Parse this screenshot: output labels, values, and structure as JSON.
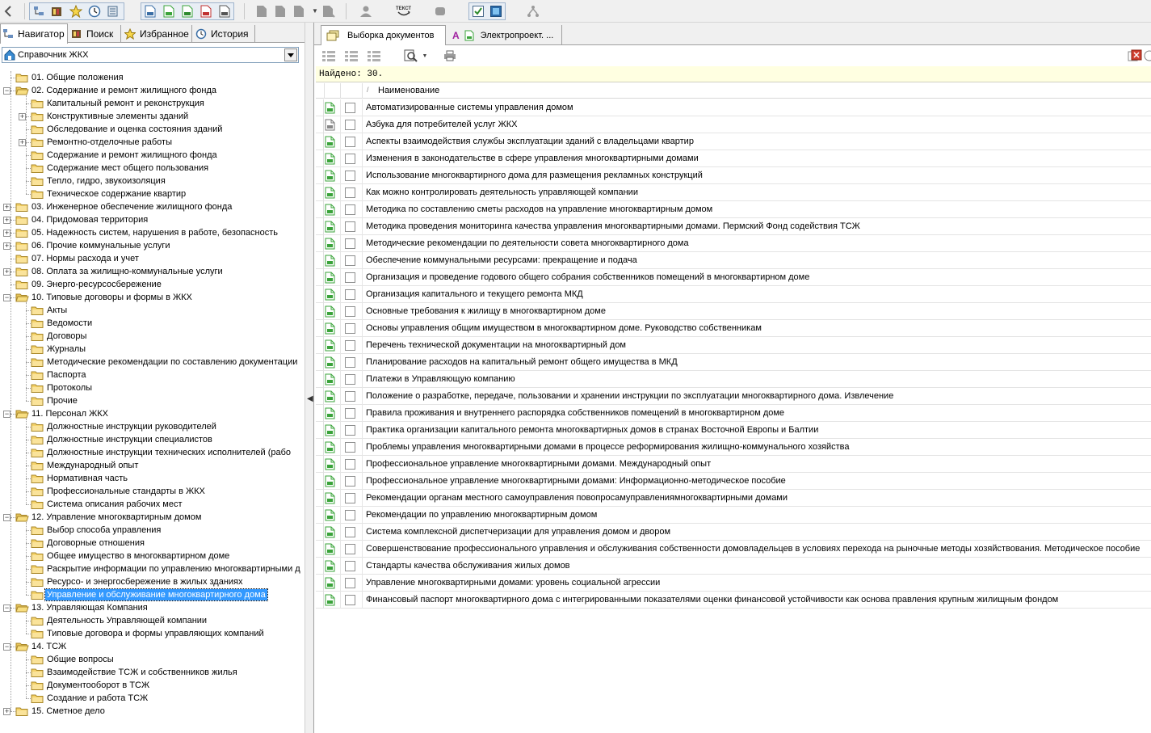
{
  "toolbar": {
    "icons": [
      "back-icon",
      "navigator-icon",
      "library-icon",
      "star-icon",
      "history-icon",
      "server-icon",
      "doc-blue-icon",
      "doc-green-icon",
      "doc-green2-icon",
      "doc-red-icon",
      "doc-gray-icon",
      "page-icon",
      "page2-icon",
      "page3-icon",
      "page4-icon",
      "user-icon",
      "text-icon",
      "stamp-icon",
      "check-icon",
      "window-icon",
      "tree-icon"
    ],
    "text_button_label": "ТЕКСТ"
  },
  "left_tabs": [
    {
      "label": "Навигатор",
      "icon": "navigator-icon",
      "active": true
    },
    {
      "label": "Поиск",
      "icon": "search-book-icon",
      "active": false
    },
    {
      "label": "Избранное",
      "icon": "star-icon",
      "active": false
    },
    {
      "label": "История",
      "icon": "clock-icon",
      "active": false
    }
  ],
  "directory_select": {
    "value": "Справочник ЖКХ"
  },
  "tree": [
    {
      "label": "01. Общие положения",
      "level": 0,
      "toggle": ""
    },
    {
      "label": "02. Содержание и ремонт жилищного фонда",
      "level": 0,
      "toggle": "−"
    },
    {
      "label": "Капитальный ремонт и реконструкция",
      "level": 1,
      "toggle": ""
    },
    {
      "label": "Конструктивные элементы зданий",
      "level": 1,
      "toggle": "+"
    },
    {
      "label": "Обследование и оценка состояния зданий",
      "level": 1,
      "toggle": ""
    },
    {
      "label": "Ремонтно-отделочные работы",
      "level": 1,
      "toggle": "+"
    },
    {
      "label": "Содержание и ремонт жилищного фонда",
      "level": 1,
      "toggle": ""
    },
    {
      "label": "Содержание мест общего пользования",
      "level": 1,
      "toggle": ""
    },
    {
      "label": "Тепло, гидро, звукоизоляция",
      "level": 1,
      "toggle": ""
    },
    {
      "label": "Техническое содержание квартир",
      "level": 1,
      "toggle": ""
    },
    {
      "label": "03. Инженерное обеспечение жилищного фонда",
      "level": 0,
      "toggle": "+"
    },
    {
      "label": "04. Придомовая территория",
      "level": 0,
      "toggle": "+"
    },
    {
      "label": "05. Надежность систем, нарушения в работе, безопасность",
      "level": 0,
      "toggle": "+"
    },
    {
      "label": "06. Прочие коммунальные услуги",
      "level": 0,
      "toggle": "+"
    },
    {
      "label": "07. Нормы расхода и учет",
      "level": 0,
      "toggle": ""
    },
    {
      "label": "08. Оплата за жилищно-коммунальные услуги",
      "level": 0,
      "toggle": "+"
    },
    {
      "label": "09. Энерго-ресурсосбережение",
      "level": 0,
      "toggle": ""
    },
    {
      "label": "10. Типовые договоры и формы в ЖКХ",
      "level": 0,
      "toggle": "−"
    },
    {
      "label": "Акты",
      "level": 1,
      "toggle": ""
    },
    {
      "label": "Ведомости",
      "level": 1,
      "toggle": ""
    },
    {
      "label": "Договоры",
      "level": 1,
      "toggle": ""
    },
    {
      "label": "Журналы",
      "level": 1,
      "toggle": ""
    },
    {
      "label": "Методические рекомендации по составлению документации",
      "level": 1,
      "toggle": ""
    },
    {
      "label": "Паспорта",
      "level": 1,
      "toggle": ""
    },
    {
      "label": "Протоколы",
      "level": 1,
      "toggle": ""
    },
    {
      "label": "Прочие",
      "level": 1,
      "toggle": ""
    },
    {
      "label": "11. Персонал ЖКХ",
      "level": 0,
      "toggle": "−"
    },
    {
      "label": "Должностные инструкции руководителей",
      "level": 1,
      "toggle": ""
    },
    {
      "label": "Должностные инструкции специалистов",
      "level": 1,
      "toggle": ""
    },
    {
      "label": "Должностные инструкции технических исполнителей (рабо",
      "level": 1,
      "toggle": ""
    },
    {
      "label": "Международный опыт",
      "level": 1,
      "toggle": ""
    },
    {
      "label": "Нормативная часть",
      "level": 1,
      "toggle": ""
    },
    {
      "label": "Профессиональные стандарты в ЖКХ",
      "level": 1,
      "toggle": ""
    },
    {
      "label": "Система описания рабочих мест",
      "level": 1,
      "toggle": ""
    },
    {
      "label": "12. Управление многоквартирным домом",
      "level": 0,
      "toggle": "−"
    },
    {
      "label": "Выбор способа управления",
      "level": 1,
      "toggle": ""
    },
    {
      "label": "Договорные отношения",
      "level": 1,
      "toggle": ""
    },
    {
      "label": "Общее имущество в многоквартирном доме",
      "level": 1,
      "toggle": ""
    },
    {
      "label": "Раскрытие информации по управлению многоквартирными д",
      "level": 1,
      "toggle": ""
    },
    {
      "label": "Ресурсо- и энергосбережение в жилых зданиях",
      "level": 1,
      "toggle": ""
    },
    {
      "label": "Управление и обслуживание многоквартирного дома",
      "level": 1,
      "toggle": "",
      "selected": true
    },
    {
      "label": "13. Управляющая Компания",
      "level": 0,
      "toggle": "−"
    },
    {
      "label": "Деятельность Управляющей компании",
      "level": 1,
      "toggle": ""
    },
    {
      "label": "Типовые договора и формы управляющих компаний",
      "level": 1,
      "toggle": ""
    },
    {
      "label": "14. ТСЖ",
      "level": 0,
      "toggle": "−"
    },
    {
      "label": " Общие вопросы",
      "level": 1,
      "toggle": ""
    },
    {
      "label": "Взаимодействие ТСЖ и собственников жилья",
      "level": 1,
      "toggle": ""
    },
    {
      "label": "Документооборот в ТСЖ",
      "level": 1,
      "toggle": ""
    },
    {
      "label": "Создание и работа ТСЖ",
      "level": 1,
      "toggle": ""
    },
    {
      "label": "15. Сметное дело",
      "level": 0,
      "toggle": "+"
    }
  ],
  "right_tabs": [
    {
      "label": "Выборка документов",
      "icon": "stack-icon",
      "active": true
    },
    {
      "label": "Электропроект. ...",
      "icon": "doc-green-icon",
      "prefix": "A",
      "active": false
    }
  ],
  "found_text": "Найдено: 30.",
  "grid": {
    "column_header": "Наименование",
    "sort_mark": "/",
    "rows": [
      {
        "name": "Автоматизированные системы управления домом",
        "icon": "doc-green"
      },
      {
        "name": "Азбука для потребителей услуг ЖКХ",
        "icon": "doc-gray"
      },
      {
        "name": "Аспекты взаимодействия службы эксплуатации зданий с владельцами квартир",
        "icon": "doc-green"
      },
      {
        "name": "Изменения в законодательстве в сфере управления многоквартирными домами",
        "icon": "doc-green"
      },
      {
        "name": "Использование многоквартирного дома для размещения рекламных конструкций",
        "icon": "doc-green"
      },
      {
        "name": "Как можно контролировать деятельность управляющей компании",
        "icon": "doc-green"
      },
      {
        "name": "Методика по составлению сметы расходов на управление многоквартирным домом",
        "icon": "doc-green"
      },
      {
        "name": "Методика проведения мониторинга качества управления многоквартирными домами. Пермский Фонд содействия ТСЖ",
        "icon": "doc-green"
      },
      {
        "name": "Методические рекомендации по деятельности совета многоквартирного дома",
        "icon": "doc-green"
      },
      {
        "name": "Обеспечение коммунальными ресурсами: прекращение и подача",
        "icon": "doc-green"
      },
      {
        "name": "Организация и проведение годового общего собрания собственников помещений в многоквартирном доме",
        "icon": "doc-green"
      },
      {
        "name": "Организация капитального и текущего ремонта МКД",
        "icon": "doc-green"
      },
      {
        "name": "Основные требования к жилищу в многоквартирном доме",
        "icon": "doc-green"
      },
      {
        "name": "Основы управления общим имуществом в многоквартирном доме. Руководство собственникам",
        "icon": "doc-green"
      },
      {
        "name": "Перечень технической документации на многоквартирный дом",
        "icon": "doc-green"
      },
      {
        "name": "Планирование расходов на капитальный ремонт общего имущества в МКД",
        "icon": "doc-green"
      },
      {
        "name": "Платежи в Управляющую компанию",
        "icon": "doc-green"
      },
      {
        "name": "Положение о разработке, передаче, пользовании и хранении инструкции по эксплуатации многоквартирного дома. Извлечение",
        "icon": "doc-green"
      },
      {
        "name": "Правила проживания и внутреннего распорядка собственников помещений в многоквартирном доме",
        "icon": "doc-green"
      },
      {
        "name": "Практика организации капитального ремонта многоквартирных домов в странах Восточной Европы и Балтии",
        "icon": "doc-green"
      },
      {
        "name": "Проблемы управления многоквартирными домами в процессе реформирования жилищно-коммунального хозяйства",
        "icon": "doc-green"
      },
      {
        "name": "Профессиональное управление многоквартирными домами. Международный опыт",
        "icon": "doc-green"
      },
      {
        "name": "Профессиональное управление многоквартирными домами: Информационно-методическое пособие",
        "icon": "doc-green"
      },
      {
        "name": "Рекомендации органам местного самоуправления повопросамуправлениямногоквартирными домами",
        "icon": "doc-green"
      },
      {
        "name": "Рекомендации по управлению многоквартирным домом",
        "icon": "doc-green"
      },
      {
        "name": "Система комплексной диспетчеризации для управления домом и двором",
        "icon": "doc-green"
      },
      {
        "name": "Совершенствование профессионального управления и обслуживания собственности домовладельцев в условиях перехода на рыночные методы хозяйствования. Методическое пособие",
        "icon": "doc-green"
      },
      {
        "name": "Стандарты качества обслуживания жилых домов",
        "icon": "doc-green"
      },
      {
        "name": "Управление многоквартирными домами: уровень социальной агрессии",
        "icon": "doc-green"
      },
      {
        "name": "Финансовый паспорт многоквартирного дома с интегрированными показателями оценки финансовой устойчивости как основа правления крупным жилищным фондом",
        "icon": "doc-green"
      }
    ]
  },
  "colors": {
    "selection": "#3399ff",
    "found_bar": "#ffffe1",
    "folder": "#f5d36b",
    "doc_green": "#3aa33a"
  }
}
